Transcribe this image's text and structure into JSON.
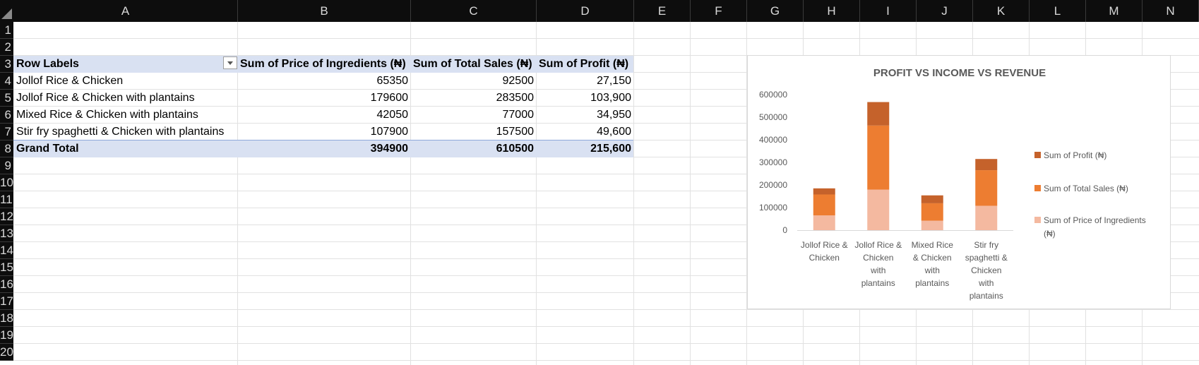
{
  "sheet": {
    "columns": [
      "A",
      "B",
      "C",
      "D",
      "E",
      "F",
      "G",
      "H",
      "I",
      "J",
      "K",
      "L",
      "M",
      "N"
    ],
    "rows": [
      "1",
      "2",
      "3",
      "4",
      "5",
      "6",
      "7",
      "8",
      "9",
      "10",
      "11",
      "12",
      "13",
      "14",
      "15",
      "16",
      "17",
      "18",
      "19",
      "20"
    ]
  },
  "pivot": {
    "headers": [
      "Row Labels",
      "Sum of Price of Ingredients (₦)",
      "Sum of Total Sales (₦)",
      "Sum of Profit (₦)"
    ],
    "rows": [
      {
        "label": "Jollof Rice & Chicken",
        "ingredients": "65350",
        "sales": "92500",
        "profit": "27,150"
      },
      {
        "label": "Jollof Rice & Chicken with plantains",
        "ingredients": "179600",
        "sales": "283500",
        "profit": "103,900"
      },
      {
        "label": "Mixed Rice & Chicken with plantains",
        "ingredients": "42050",
        "sales": "77000",
        "profit": "34,950"
      },
      {
        "label": "Stir fry spaghetti & Chicken with plantains",
        "ingredients": "107900",
        "sales": "157500",
        "profit": "49,600"
      }
    ],
    "grand_total": {
      "label": "Grand Total",
      "ingredients": "394900",
      "sales": "610500",
      "profit": "215,600"
    }
  },
  "chart_data": {
    "type": "bar",
    "stacked": true,
    "title": "PROFIT VS INCOME VS REVENUE",
    "categories": [
      [
        "Jollof Rice &",
        "Chicken"
      ],
      [
        "Jollof Rice &",
        "Chicken",
        "with",
        "plantains"
      ],
      [
        "Mixed Rice",
        "& Chicken",
        "with",
        "plantains"
      ],
      [
        "Stir fry",
        "spaghetti &",
        "Chicken",
        "with",
        "plantains"
      ]
    ],
    "series": [
      {
        "name": "Sum of Price of Ingredients (₦)",
        "values": [
          65350,
          179600,
          42050,
          107900
        ],
        "color": "#f4b9a0"
      },
      {
        "name": "Sum of Total Sales (₦)",
        "values": [
          92500,
          283500,
          77000,
          157500
        ],
        "color": "#ed7d31"
      },
      {
        "name": "Sum of Profit (₦)",
        "values": [
          27150,
          103900,
          34950,
          49600
        ],
        "color": "#c5622b"
      }
    ],
    "legend_order": [
      2,
      1,
      0
    ],
    "legend_labels": [
      [
        "Sum of Profit (₦)"
      ],
      [
        "Sum of Total Sales (₦)"
      ],
      [
        "Sum of Price of Ingredients",
        "(₦)"
      ]
    ],
    "yticks": [
      "0",
      "100000",
      "200000",
      "300000",
      "400000",
      "500000",
      "600000"
    ],
    "ylim": [
      0,
      600000
    ],
    "legend_position": "right",
    "grid": false
  }
}
